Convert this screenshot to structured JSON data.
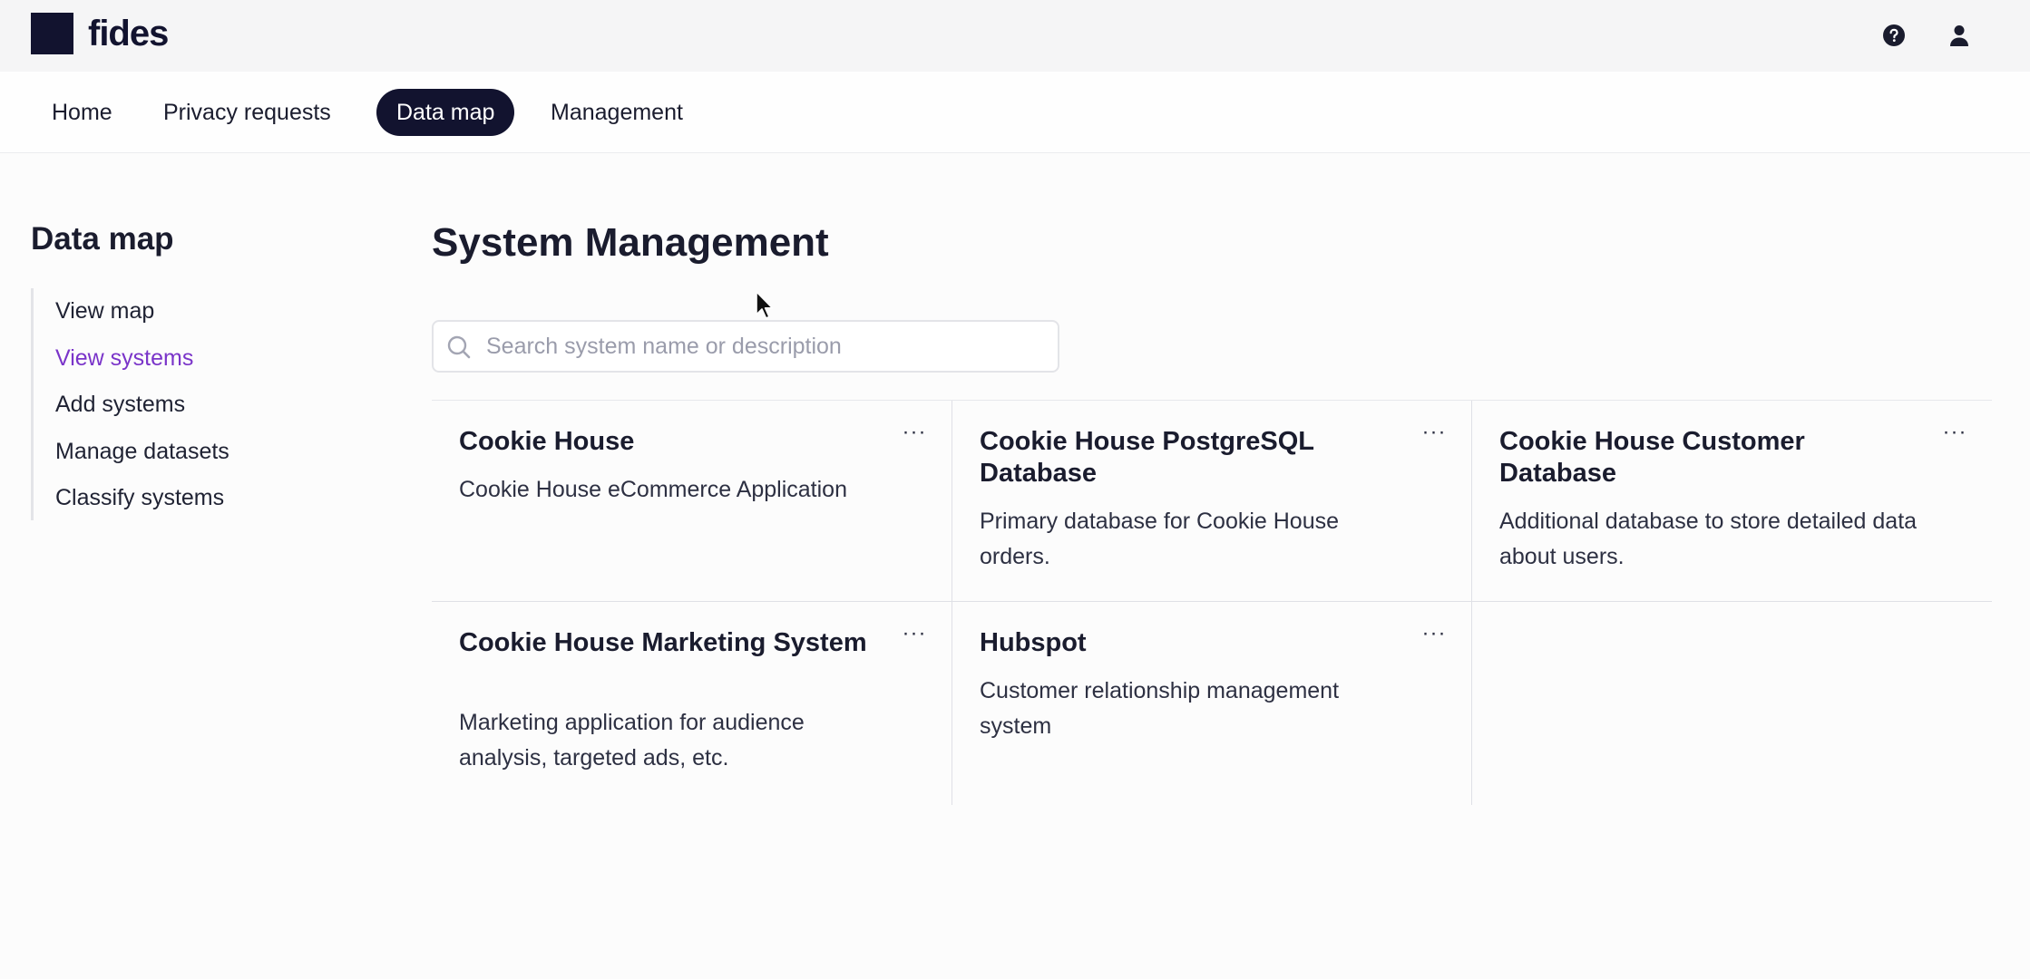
{
  "brand": {
    "name": "fides"
  },
  "top_icons": {
    "help": "help-icon",
    "user": "user-icon"
  },
  "nav": {
    "items": [
      {
        "label": "Home",
        "active": false
      },
      {
        "label": "Privacy requests",
        "active": false
      },
      {
        "label": "Data map",
        "active": true
      },
      {
        "label": "Management",
        "active": false
      }
    ]
  },
  "sidebar": {
    "title": "Data map",
    "items": [
      {
        "label": "View map",
        "active": false
      },
      {
        "label": "View systems",
        "active": true
      },
      {
        "label": "Add systems",
        "active": false
      },
      {
        "label": "Manage datasets",
        "active": false
      },
      {
        "label": "Classify systems",
        "active": false
      }
    ]
  },
  "main": {
    "title": "System Management",
    "search": {
      "placeholder": "Search system name or description",
      "value": ""
    },
    "more_label": "···",
    "systems": [
      {
        "name": "Cookie House",
        "description": "Cookie House eCommerce Application"
      },
      {
        "name": "Cookie House PostgreSQL Database",
        "description": "Primary database for Cookie House orders."
      },
      {
        "name": "Cookie House Customer Database",
        "description": "Additional database to store detailed data about users."
      },
      {
        "name": "Cookie House Marketing System",
        "description": "Marketing application for audience analysis, targeted ads, etc."
      },
      {
        "name": "Hubspot",
        "description": "Customer relationship management system"
      }
    ]
  },
  "colors": {
    "brand": "#12132f",
    "accent": "#7a34c9",
    "border": "#dfe0e6"
  }
}
